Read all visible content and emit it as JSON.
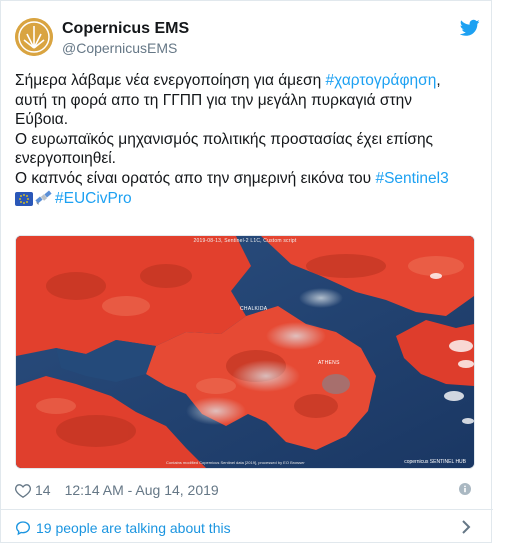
{
  "account": {
    "display_name": "Copernicus EMS",
    "handle": "@CopernicusEMS"
  },
  "tweet": {
    "line1_pre": "Σήμερα λάβαμε νέα ενεργοποίηση για άμεση ",
    "line1_tag": "#χαρτογράφηση",
    "line1_post": ",",
    "line2": "αυτή τη φορά απο τη ΓΓΠΠ για την μεγάλη πυρκαγιά στην",
    "line3": "Εύβοια.",
    "line4": "Ο ευρωπαϊκός μηχανισμός πολιτικής προστασίας έχει επίσης",
    "line5": "ενεργοποιηθεί.",
    "line6_pre": "Ο καπνός είναι ορατός απο την σημερινή εικόνα του ",
    "line6_tag": "#Sentinel3",
    "line7_tag": "#EUCivPro"
  },
  "media": {
    "caption": "2019-08-13, Sentinel-2 L1C, Custom script",
    "credit": "Contains modified Copernicus Sentinel data [2019], processed by EO Browser",
    "logos": "copernicus  SENTINEL HUB",
    "place_athens": "ATHENS",
    "place_chalkida": "CHALKIDA"
  },
  "meta": {
    "likes": "14",
    "timestamp": "12:14 AM - Aug 14, 2019"
  },
  "talking": {
    "label": "19 people are talking about this"
  },
  "icons": {
    "bird": "twitter-bird-icon",
    "heart": "heart-icon",
    "info": "info-icon",
    "bubble": "speech-bubble-icon",
    "chevron": "chevron-right-icon"
  },
  "colors": {
    "link": "#1da1f2",
    "secondary_text": "#657786",
    "avatar": "#d9a441",
    "vegetation_red": "#e8432f",
    "sea": "#1f3f6b"
  }
}
